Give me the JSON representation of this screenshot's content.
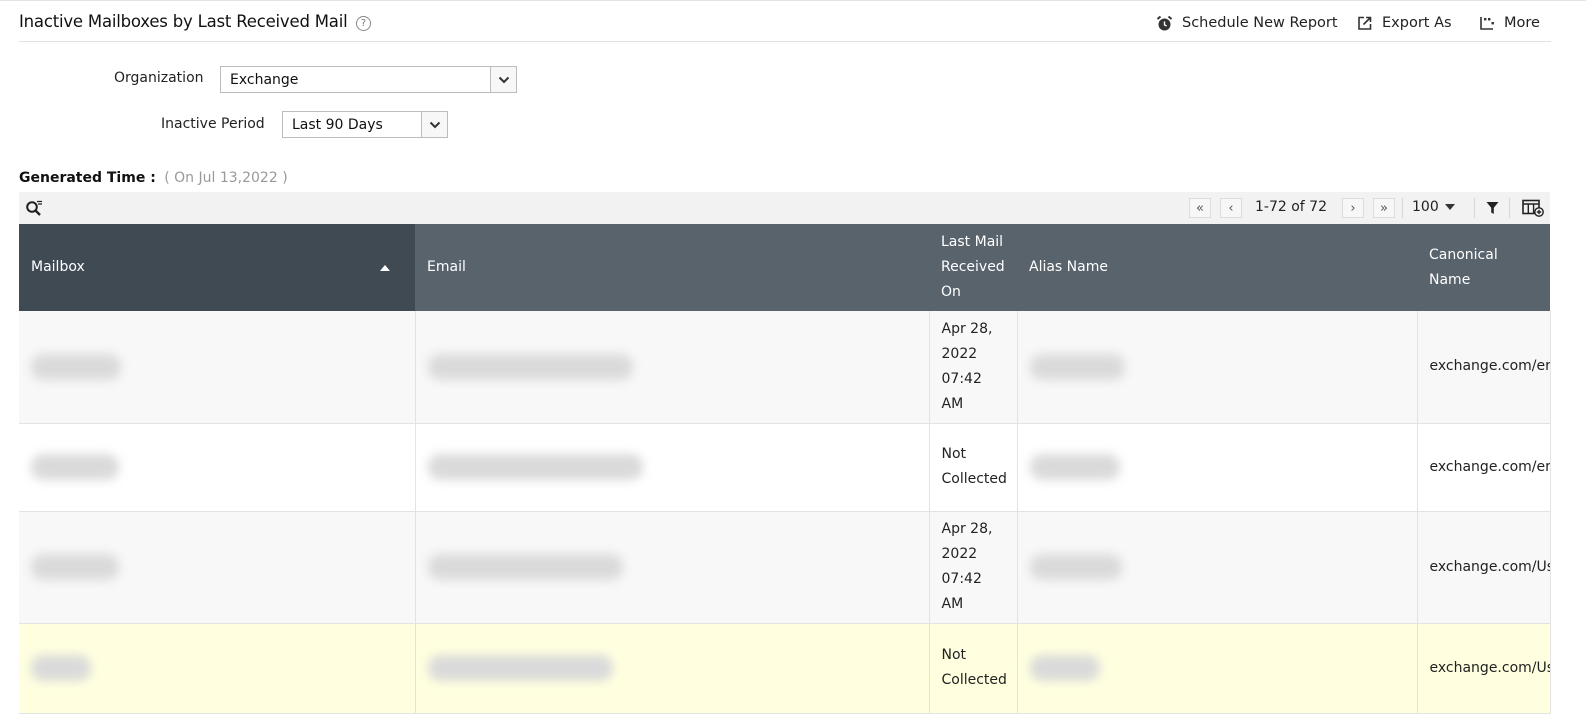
{
  "header": {
    "title": "Inactive Mailboxes by Last Received Mail",
    "help_glyph": "?",
    "actions": {
      "schedule": "Schedule New Report",
      "export": "Export As",
      "more": "More"
    }
  },
  "filters": {
    "organization_label": "Organization",
    "organization_value": "Exchange",
    "period_label": "Inactive Period",
    "period_value": "Last 90 Days"
  },
  "generated": {
    "label": "Generated Time :",
    "value": "( On Jul 13,2022 )"
  },
  "toolbar": {
    "page_range": "1-72 of 72",
    "page_size": "100",
    "first_glyph": "«",
    "prev_glyph": "‹",
    "next_glyph": "›",
    "last_glyph": "»"
  },
  "table": {
    "columns": {
      "mailbox": "Mailbox",
      "email": "Email",
      "last_mail": "Last Mail Received On",
      "alias": "Alias Name",
      "canonical": "Canonical Name"
    },
    "sort": "ascending",
    "rows": [
      {
        "last_mail": "Apr 28, 2022 07:42 AM",
        "canonical": "exchange.com/er"
      },
      {
        "last_mail": "Not Collected",
        "canonical": "exchange.com/er"
      },
      {
        "last_mail": "Apr 28, 2022 07:42 AM",
        "canonical": "exchange.com/Us"
      },
      {
        "last_mail": "Not Collected",
        "canonical": "exchange.com/Us"
      }
    ]
  },
  "colors": {
    "header_bg": "#58636b",
    "sorted_header_bg": "#3f4a53",
    "highlight_row": "#ffffe0"
  }
}
